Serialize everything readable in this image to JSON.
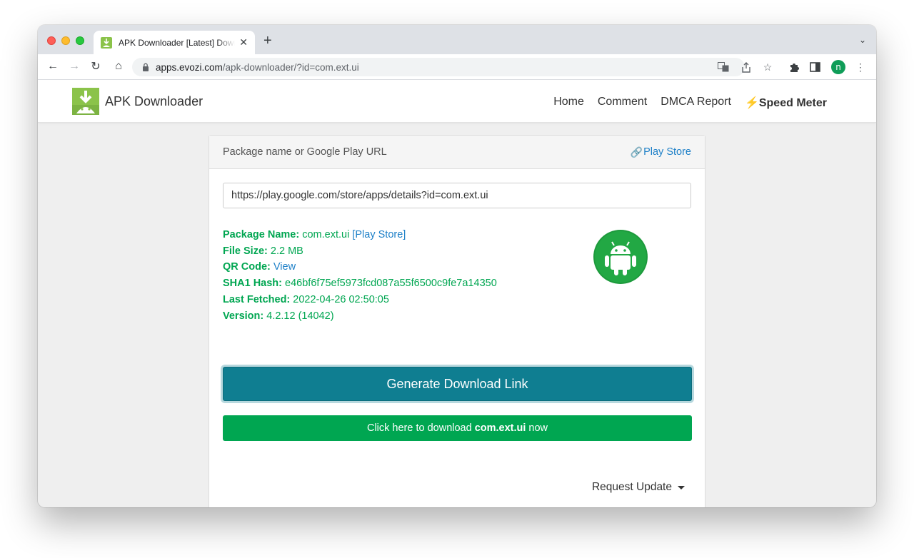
{
  "browser": {
    "tab_title": "APK Downloader [Latest] Download Directly",
    "url_host": "apps.evozi.com",
    "url_path": "/apk-downloader/?id=com.ext.ui",
    "profile_initial": "n"
  },
  "site": {
    "brand": "APK Downloader",
    "nav": [
      "Home",
      "Comment",
      "DMCA Report",
      "Speed Meter"
    ]
  },
  "card": {
    "header_label": "Package name or Google Play URL",
    "play_store_link": "Play Store",
    "input_value": "https://play.google.com/store/apps/details?id=com.ext.ui",
    "info": {
      "package_name_label": "Package Name:",
      "package_name": "com.ext.ui",
      "package_link": "[Play Store]",
      "file_size_label": "File Size:",
      "file_size": "2.2 MB",
      "qr_label": "QR Code:",
      "qr_link": "View",
      "sha1_label": "SHA1 Hash:",
      "sha1": "e46bf6f75ef5973fcd087a55f6500c9fe7a14350",
      "fetched_label": "Last Fetched:",
      "fetched": "2022-04-26 02:50:05",
      "version_label": "Version:",
      "version": "4.2.12 (14042)"
    },
    "generate_button": "Generate Download Link",
    "download_prefix": "Click here to download",
    "download_package": "com.ext.ui",
    "download_suffix": "now",
    "request_update": "Request Update"
  },
  "colors": {
    "accent_teal": "#0f7e91",
    "success_green": "#00a651",
    "link_blue": "#1e80c8"
  }
}
